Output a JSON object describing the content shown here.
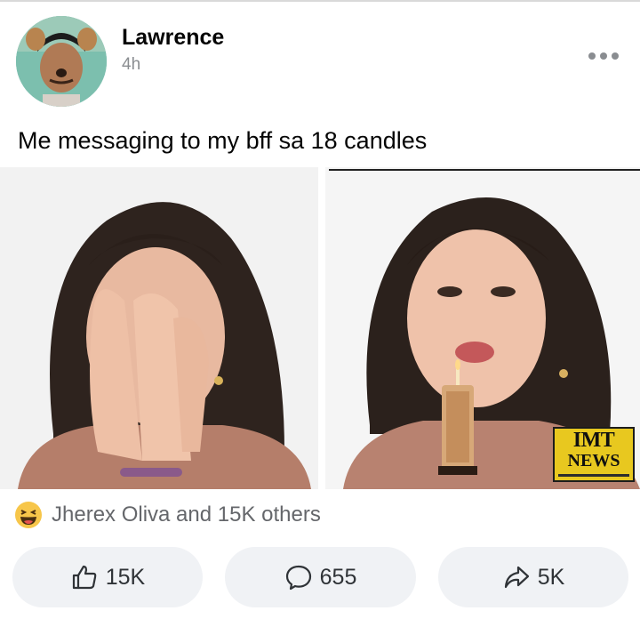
{
  "post": {
    "author": "Lawrence",
    "time": "4h",
    "caption": "Me messaging to my bff sa 18 candles"
  },
  "media": {
    "watermark_line1": "IMT",
    "watermark_line2": "NEWS",
    "watermark_color": "#e8c81f"
  },
  "reactions": {
    "icon": "haha-emoji-icon",
    "text": "Jherex Oliva and 15K others"
  },
  "actions": {
    "like": {
      "icon": "thumbs-up-icon",
      "count": "15K"
    },
    "comment": {
      "icon": "comment-bubble-icon",
      "count": "655"
    },
    "share": {
      "icon": "share-arrow-icon",
      "count": "5K"
    }
  },
  "colors": {
    "muted_text": "#8a8d91",
    "button_bg": "#f0f2f5",
    "reaction_text": "#65676b"
  }
}
